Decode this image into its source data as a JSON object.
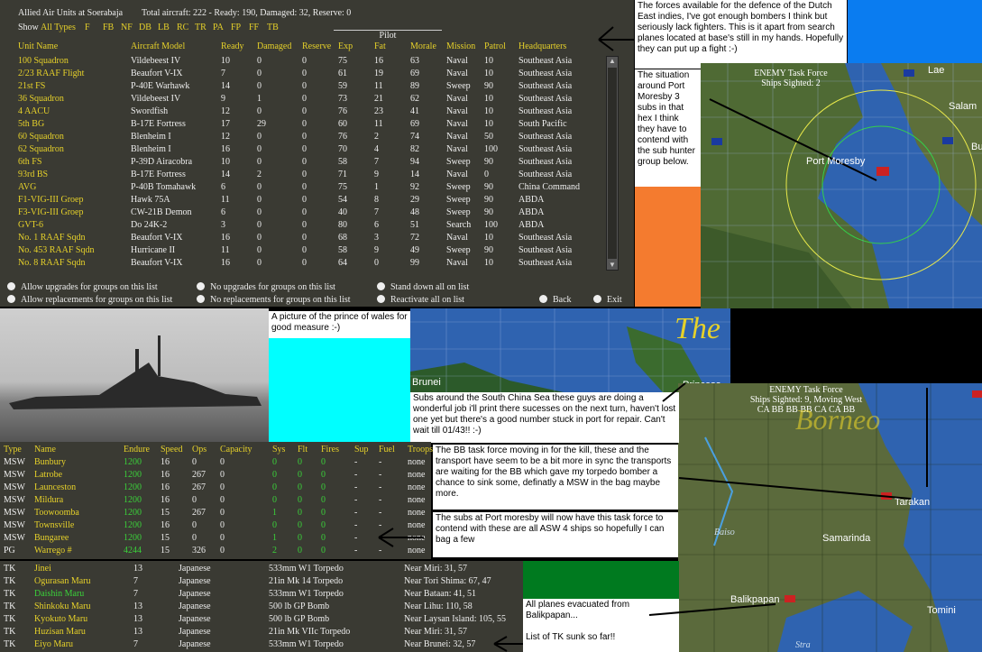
{
  "air": {
    "title": "Allied Air Units at Soerabaja",
    "summary": "Total aircraft: 222 - Ready: 190, Damaged: 32, Reserve: 0",
    "show_label": "Show",
    "filters": [
      "All Types",
      "F",
      "FB",
      "NF",
      "DB",
      "LB",
      "RC",
      "TR",
      "PA",
      "FP",
      "FF",
      "TB"
    ],
    "pilot_label": "Pilot",
    "columns": [
      "Unit Name",
      "Aircraft Model",
      "Ready",
      "Damaged",
      "Reserve",
      "Exp",
      "Fat",
      "Morale",
      "Mission",
      "Patrol",
      "Headquarters"
    ],
    "rows": [
      [
        "100 Squadron",
        "Vildebeest IV",
        "10",
        "0",
        "0",
        "75",
        "16",
        "63",
        "Naval",
        "10",
        "Southeast Asia"
      ],
      [
        "2/23 RAAF Flight",
        "Beaufort V-IX",
        "7",
        "0",
        "0",
        "61",
        "19",
        "69",
        "Naval",
        "10",
        "Southeast Asia"
      ],
      [
        "21st FS",
        "P-40E Warhawk",
        "14",
        "0",
        "0",
        "59",
        "11",
        "89",
        "Sweep",
        "90",
        "Southeast Asia"
      ],
      [
        "36 Squadron",
        "Vildebeest IV",
        "9",
        "1",
        "0",
        "73",
        "21",
        "62",
        "Naval",
        "10",
        "Southeast Asia"
      ],
      [
        "4 AACU",
        "Swordfish",
        "12",
        "0",
        "0",
        "76",
        "23",
        "41",
        "Naval",
        "10",
        "Southeast Asia"
      ],
      [
        "5th BG",
        "B-17E Fortress",
        "17",
        "29",
        "0",
        "60",
        "11",
        "69",
        "Naval",
        "10",
        "South Pacific"
      ],
      [
        "60 Squadron",
        "Blenheim I",
        "12",
        "0",
        "0",
        "76",
        "2",
        "74",
        "Naval",
        "50",
        "Southeast Asia"
      ],
      [
        "62 Squadron",
        "Blenheim I",
        "16",
        "0",
        "0",
        "70",
        "4",
        "82",
        "Naval",
        "100",
        "Southeast Asia"
      ],
      [
        "6th FS",
        "P-39D Airacobra",
        "10",
        "0",
        "0",
        "58",
        "7",
        "94",
        "Sweep",
        "90",
        "Southeast Asia"
      ],
      [
        "93rd BS",
        "B-17E Fortress",
        "14",
        "2",
        "0",
        "71",
        "9",
        "14",
        "Naval",
        "0",
        "Southeast Asia"
      ],
      [
        "AVG",
        "P-40B Tomahawk",
        "6",
        "0",
        "0",
        "75",
        "1",
        "92",
        "Sweep",
        "90",
        "China Command"
      ],
      [
        "F1-VIG-III Groep",
        "Hawk 75A",
        "11",
        "0",
        "0",
        "54",
        "8",
        "29",
        "Sweep",
        "90",
        "ABDA"
      ],
      [
        "F3-VIG-III Groep",
        "CW-21B Demon",
        "6",
        "0",
        "0",
        "40",
        "7",
        "48",
        "Sweep",
        "90",
        "ABDA"
      ],
      [
        "GVT-6",
        "Do 24K-2",
        "3",
        "0",
        "0",
        "80",
        "6",
        "51",
        "Search",
        "100",
        "ABDA"
      ],
      [
        "No. 1 RAAF Sqdn",
        "Beaufort V-IX",
        "16",
        "0",
        "0",
        "68",
        "3",
        "72",
        "Naval",
        "10",
        "Southeast Asia"
      ],
      [
        "No. 453 RAAF Sqdn",
        "Hurricane II",
        "11",
        "0",
        "0",
        "58",
        "9",
        "49",
        "Sweep",
        "90",
        "Southeast Asia"
      ],
      [
        "No. 8 RAAF Sqdn",
        "Beaufort V-IX",
        "16",
        "0",
        "0",
        "64",
        "0",
        "99",
        "Naval",
        "10",
        "Southeast Asia"
      ]
    ],
    "options": [
      "Allow upgrades for groups on this list",
      "No upgrades for groups on this list",
      "Stand down all on list",
      "Allow replacements for groups on this list",
      "No replacements for groups on this list",
      "Reactivate all on list"
    ],
    "back": "Back",
    "exit": "Exit"
  },
  "notes": {
    "top_right": "The forces available for the defence of the Dutch East indies, I've got enough bombers I think but seriously lack fighters. This is it apart from search planes located at base's still in my hands.  Hopefully they can put up a fight :-)",
    "port_moresby": "The situation around Port Moresby 3 subs in that hex I think they have to contend with the sub hunter group below.",
    "prince": "A picture of the prince of wales for good measure :-)",
    "subs": "Subs around the South China Sea these guys are doing a wonderful job i'll print there sucesses on the next turn, haven't lost one yet but there's a good number stuck in port for repair. Can't wait till 01/43!! :-)",
    "bb": "The BB task force moving in for the kill, these and the transport have seem to be a bit more in sync the transports are waiting for the BB which gave my torpedo bomber a chance to sink some, definatly a MSW in the bag maybe more.",
    "asw": "The subs at Port moresby will now have this task force to contend with these are all ASW 4 ships so hopefully I can bag a few",
    "evac": "All planes evacuated from Balikpapan...",
    "tk": "List of TK sunk so far!!"
  },
  "map1": {
    "task_force": "ENEMY Task Force",
    "sighted": "Ships Sighted: 2",
    "labels": [
      "Lae",
      "Salam",
      "Port Moresby",
      "Bu"
    ]
  },
  "map2": {
    "title": "The",
    "labels": [
      "Brunei",
      "Princesa"
    ]
  },
  "map3": {
    "task_force": "ENEMY Task Force",
    "sighted": "Ships Sighted: 9, Moving West",
    "ships": "CA BB BB BB CA CA BB",
    "borneo": "Borneo",
    "labels": [
      "Tarakan",
      "Samarinda",
      "Balikpapan",
      "Tomini",
      "Baiso",
      "Stra"
    ]
  },
  "ships": {
    "columns": [
      "Type",
      "Name",
      "Endure",
      "Speed",
      "Ops",
      "Capacity",
      "Sys",
      "Flt",
      "Fires",
      "Sup",
      "Fuel",
      "Troops"
    ],
    "rows": [
      [
        "MSW",
        "Bunbury",
        "1200",
        "16",
        "0",
        "0",
        "0",
        "0",
        "0",
        "-",
        "-",
        "none"
      ],
      [
        "MSW",
        "Latrobe",
        "1200",
        "16",
        "267",
        "0",
        "0",
        "0",
        "0",
        "-",
        "-",
        "none"
      ],
      [
        "MSW",
        "Launceston",
        "1200",
        "16",
        "267",
        "0",
        "0",
        "0",
        "0",
        "-",
        "-",
        "none"
      ],
      [
        "MSW",
        "Mildura",
        "1200",
        "16",
        "0",
        "0",
        "0",
        "0",
        "0",
        "-",
        "-",
        "none"
      ],
      [
        "MSW",
        "Toowoomba",
        "1200",
        "15",
        "267",
        "0",
        "1",
        "0",
        "0",
        "-",
        "-",
        "none"
      ],
      [
        "MSW",
        "Townsville",
        "1200",
        "16",
        "0",
        "0",
        "0",
        "0",
        "0",
        "-",
        "-",
        "none"
      ],
      [
        "MSW",
        "Bungaree",
        "1200",
        "15",
        "0",
        "0",
        "1",
        "0",
        "0",
        "-",
        "-",
        "none"
      ],
      [
        "PG",
        "Warrego #",
        "4244",
        "15",
        "326",
        "0",
        "2",
        "0",
        "0",
        "-",
        "-",
        "none"
      ]
    ]
  },
  "tk": {
    "rows": [
      [
        "TK",
        "Jinei",
        "13",
        "Japanese",
        "533mm W1 Torpedo",
        "Near Miri: 31, 57"
      ],
      [
        "TK",
        "Ogurasan Maru",
        "7",
        "Japanese",
        "21in Mk 14 Torpedo",
        "Near Tori Shima: 67, 47"
      ],
      [
        "TK",
        "Daishin Maru",
        "7",
        "Japanese",
        "533mm W1 Torpedo",
        "Near Bataan: 41, 51"
      ],
      [
        "TK",
        "Shinkoku Maru",
        "13",
        "Japanese",
        "500 lb GP Bomb",
        "Near Lihu: 110, 58"
      ],
      [
        "TK",
        "Kyokuto Maru",
        "13",
        "Japanese",
        "500 lb GP Bomb",
        "Near Laysan Island: 105, 55"
      ],
      [
        "TK",
        "Huzisan Maru",
        "13",
        "Japanese",
        "21in Mk VIIc Torpedo",
        "Near Miri: 31, 57"
      ],
      [
        "TK",
        "Eiyo Maru",
        "7",
        "Japanese",
        "533mm W1 Torpedo",
        "Near Brunei: 32, 57"
      ]
    ]
  },
  "colors": {
    "panel": "#3a3a33",
    "highlight": "#e6d12a",
    "sea": "#2f63b0",
    "cyan": "#00ffff",
    "orange": "#f47b2f",
    "green": "#007a1f",
    "bright_blue": "#0a7cf0"
  }
}
